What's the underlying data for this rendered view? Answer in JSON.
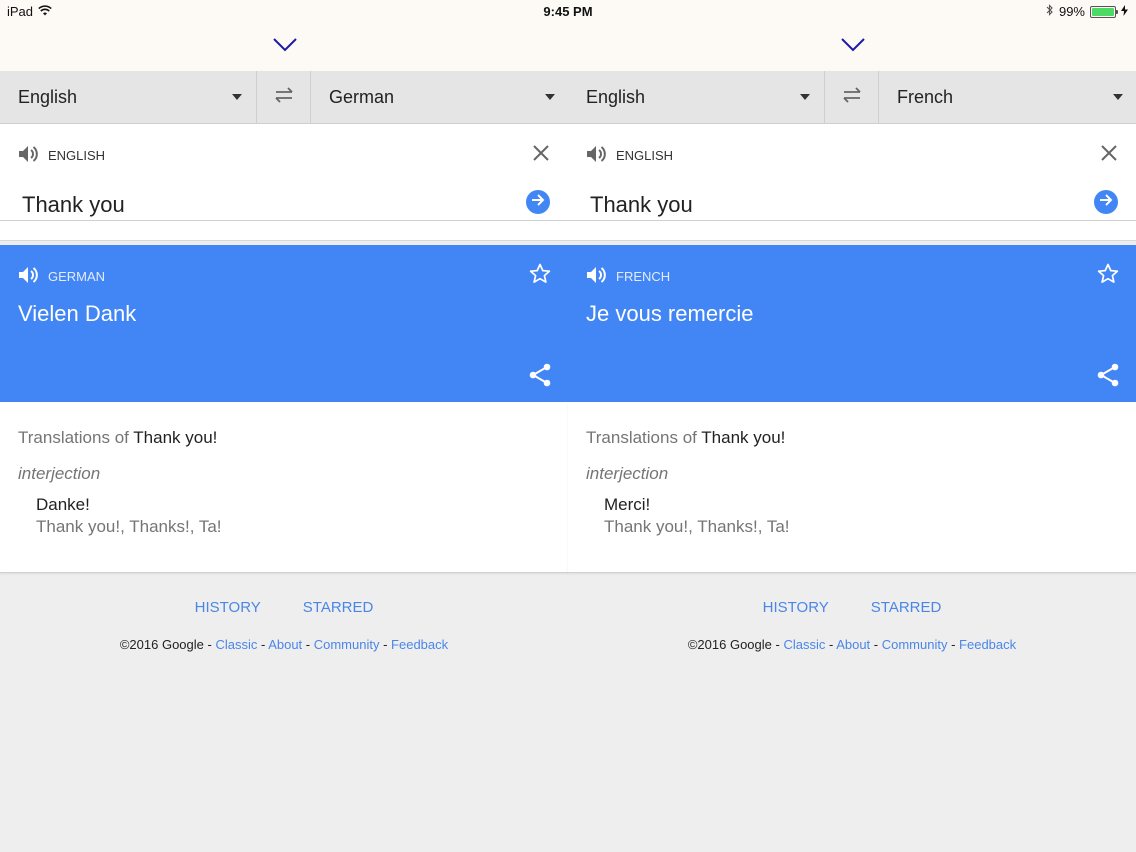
{
  "status_bar": {
    "device": "iPad",
    "time": "9:45 PM",
    "battery": "99%",
    "battery_level": 0.99
  },
  "panes": [
    {
      "source_lang": "English",
      "target_lang": "German",
      "input_lang_label": "ENGLISH",
      "input_text": "Thank you",
      "output_lang_label": "GERMAN",
      "output_text": "Vielen Dank",
      "dict": {
        "title_prefix": "Translations of",
        "title_term": "Thank you!",
        "pos": "interjection",
        "word": "Danke!",
        "back_translations": "Thank you!, Thanks!, Ta!"
      }
    },
    {
      "source_lang": "English",
      "target_lang": "French",
      "input_lang_label": "ENGLISH",
      "input_text": "Thank you",
      "output_lang_label": "FRENCH",
      "output_text": "Je vous remercie",
      "dict": {
        "title_prefix": "Translations of",
        "title_term": "Thank you!",
        "pos": "interjection",
        "word": "Merci!",
        "back_translations": "Thank you!, Thanks!, Ta!"
      }
    }
  ],
  "footer": {
    "history": "HISTORY",
    "starred": "STARRED",
    "copyright": "©2016 Google",
    "classic": "Classic",
    "about": "About",
    "community": "Community",
    "feedback": "Feedback"
  },
  "colors": {
    "accent": "#4285f4",
    "link": "#4a86e8",
    "background": "#eeeeee"
  },
  "icons": [
    "wifi-icon",
    "bluetooth-icon",
    "battery-icon",
    "chevron-down-icon",
    "swap-icon",
    "speaker-icon",
    "close-icon",
    "arrow-right-icon",
    "star-icon",
    "share-icon"
  ]
}
